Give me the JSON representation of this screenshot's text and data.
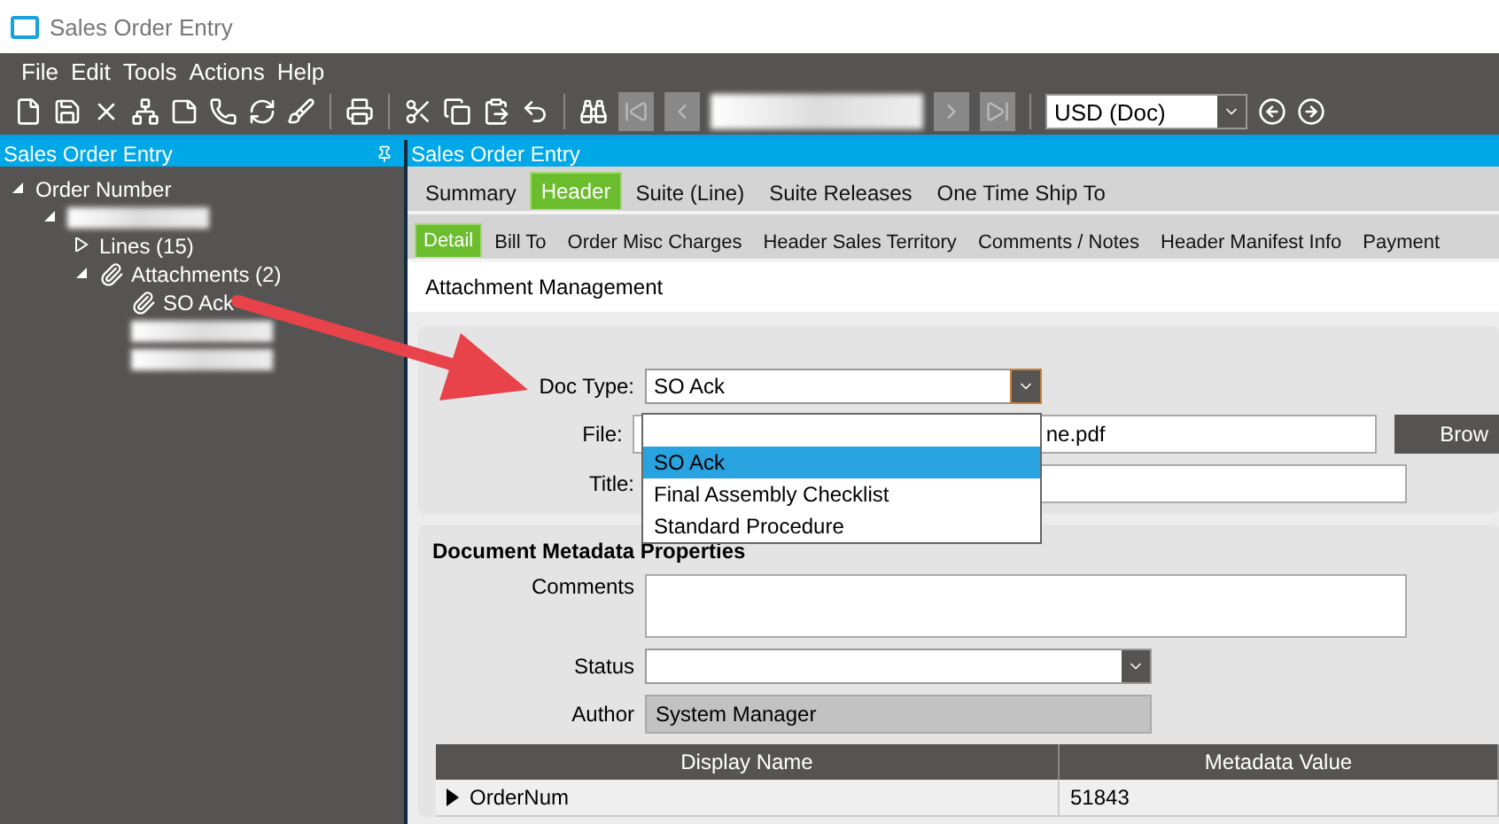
{
  "window": {
    "title": "Sales Order Entry"
  },
  "menu": [
    "File",
    "Edit",
    "Tools",
    "Actions",
    "Help"
  ],
  "toolbar": {
    "currency": "USD (Doc)"
  },
  "tree_panel": {
    "title": "Sales Order Entry",
    "nodes": [
      {
        "kind": "text",
        "label": "Order Number",
        "expanded": true,
        "children": [
          {
            "kind": "redacted",
            "expanded": true,
            "children": [
              {
                "kind": "text",
                "label": "Lines (15)",
                "expanded": false
              },
              {
                "kind": "attachments",
                "label": "Attachments (2)",
                "expanded": true,
                "children": [
                  {
                    "kind": "attachment",
                    "label": "SO Ack"
                  },
                  {
                    "kind": "redacted"
                  },
                  {
                    "kind": "redacted"
                  }
                ]
              }
            ]
          }
        ]
      }
    ]
  },
  "main_panel": {
    "title": "Sales Order Entry",
    "tabs": [
      {
        "label": "Summary",
        "selected": false
      },
      {
        "label": "Header",
        "selected": true
      },
      {
        "label": "Suite (Line)",
        "selected": false
      },
      {
        "label": "Suite Releases",
        "selected": false
      },
      {
        "label": "One Time Ship To",
        "selected": false
      }
    ],
    "subtabs": [
      {
        "label": "Detail",
        "selected": true
      },
      {
        "label": "Bill To",
        "selected": false
      },
      {
        "label": "Order Misc Charges",
        "selected": false
      },
      {
        "label": "Header Sales Territory",
        "selected": false
      },
      {
        "label": "Comments / Notes",
        "selected": false
      },
      {
        "label": "Header Manifest Info",
        "selected": false
      },
      {
        "label": "Payment",
        "selected": false
      }
    ],
    "section_title": "Attachment Management",
    "properties": {
      "doc_type": {
        "label": "Doc Type:",
        "value": "SO Ack",
        "expanded": true,
        "options": [
          {
            "kind": "blank",
            "selected": false
          },
          {
            "kind": "option",
            "label": "SO Ack",
            "selected": true
          },
          {
            "kind": "option",
            "label": "Final Assembly Checklist",
            "selected": false
          },
          {
            "kind": "option",
            "label": "Standard Procedure",
            "selected": false
          }
        ]
      },
      "file": {
        "label": "File:",
        "value": "ne.pdf"
      },
      "browse_button": "Brow",
      "title_field": {
        "label": "Title:"
      }
    },
    "metadata": {
      "heading": "Document Metadata Properties",
      "comments": {
        "label": "Comments"
      },
      "status": {
        "label": "Status"
      },
      "author": {
        "label": "Author",
        "value": "System Manager"
      },
      "grid": {
        "columns": [
          "Display Name",
          "Metadata Value"
        ],
        "rows": [
          {
            "current": true,
            "cells": [
              "OrderNum",
              "51843"
            ]
          }
        ]
      }
    }
  }
}
